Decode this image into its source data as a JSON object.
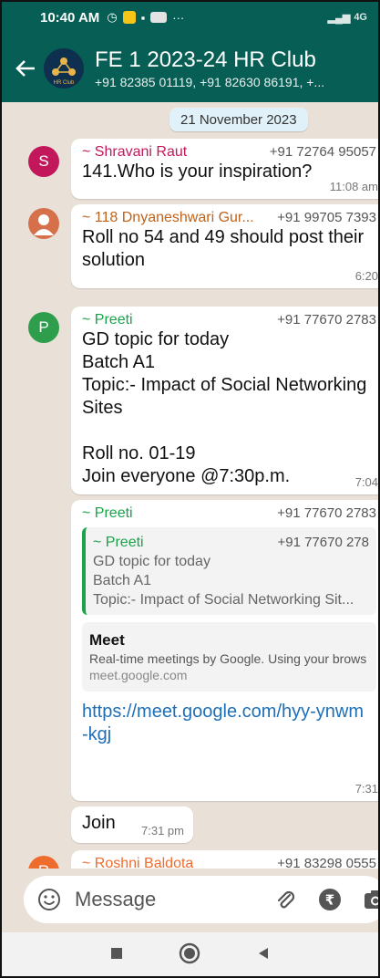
{
  "status_bar": {
    "time": "10:40 AM",
    "misc": "···",
    "network": "4G"
  },
  "header": {
    "back_icon": "arrow-left-icon",
    "avatar_label": "HR Club",
    "title": "FE 1 2023-24 HR Club",
    "participants": "+91 82385 01119, +91 82630 86191, +..."
  },
  "date_chip": "21 November 2023",
  "messages": [
    {
      "avatar_letter": "S",
      "avatar_color": "#c2185b",
      "sender": "~ Shravani Raut",
      "phone": "+91 72764 95057",
      "text": "141.Who is your inspiration?",
      "time": "11:08 am"
    },
    {
      "avatar_letter": "",
      "avatar_color": "#d5704a",
      "sender": "~ 118 Dnyaneshwari Gur...",
      "phone": "+91 99705 7393",
      "text_lines": [
        "Roll no 54 and 49 should post their",
        "solution"
      ],
      "time": "6:20"
    },
    {
      "avatar_letter": "P",
      "avatar_color": "#2e9e4d",
      "sender": "~ Preeti",
      "phone": "+91 77670 2783",
      "text_lines": [
        "GD topic for today",
        "Batch A1",
        "Topic:- Impact of Social Networking",
        "Sites",
        "",
        "Roll no. 01-19",
        "Join everyone @7:30p.m."
      ],
      "time": "7:04"
    },
    {
      "sender": "~ Preeti",
      "phone": "+91 77670 2783",
      "quote": {
        "sender": "~ Preeti",
        "phone": "+91 77670 278",
        "lines": [
          "GD topic for today",
          "Batch A1",
          "Topic:- Impact of Social Networking Sit..."
        ]
      },
      "preview": {
        "title": "Meet",
        "description": "Real-time meetings by Google. Using your brows",
        "domain": "meet.google.com"
      },
      "link_lines": [
        "https://meet.google.com/hyy-ynwm",
        "-kgj"
      ],
      "time": "7:31"
    },
    {
      "text": "Join",
      "time": "7:31 pm"
    },
    {
      "avatar_letter": "R",
      "avatar_color": "#ef6c2f",
      "sender": "~ Roshni Baldota",
      "phone": "+91 83298 0555"
    }
  ],
  "composer": {
    "placeholder": "Message",
    "icons": [
      "emoji-icon",
      "attach-icon",
      "rupee-icon",
      "camera-icon"
    ]
  },
  "nav": {
    "icons": [
      "recent-apps-icon",
      "home-icon",
      "back-triangle-icon"
    ]
  },
  "colors": {
    "header": "#075e54",
    "chat_bg": "#e9e1d8",
    "link": "#1e6fb8",
    "sender_green": "#1aa34a"
  }
}
